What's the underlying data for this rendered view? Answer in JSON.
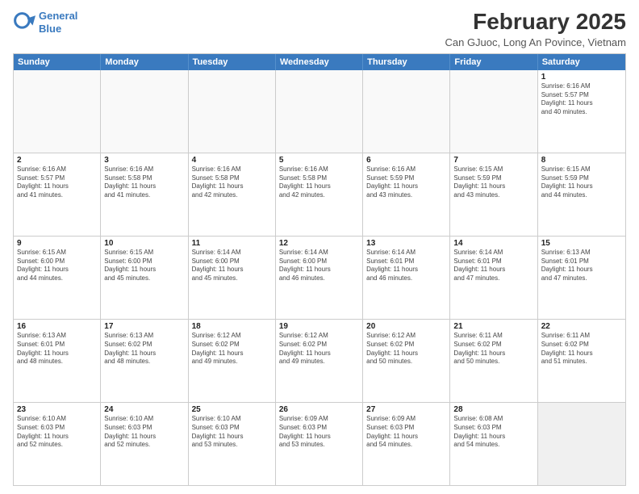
{
  "header": {
    "logo_line1": "General",
    "logo_line2": "Blue",
    "month_title": "February 2025",
    "subtitle": "Can GJuoc, Long An Povince, Vietnam"
  },
  "weekdays": [
    "Sunday",
    "Monday",
    "Tuesday",
    "Wednesday",
    "Thursday",
    "Friday",
    "Saturday"
  ],
  "weeks": [
    [
      {
        "day": "",
        "info": ""
      },
      {
        "day": "",
        "info": ""
      },
      {
        "day": "",
        "info": ""
      },
      {
        "day": "",
        "info": ""
      },
      {
        "day": "",
        "info": ""
      },
      {
        "day": "",
        "info": ""
      },
      {
        "day": "1",
        "info": "Sunrise: 6:16 AM\nSunset: 5:57 PM\nDaylight: 11 hours\nand 40 minutes."
      }
    ],
    [
      {
        "day": "2",
        "info": "Sunrise: 6:16 AM\nSunset: 5:57 PM\nDaylight: 11 hours\nand 41 minutes."
      },
      {
        "day": "3",
        "info": "Sunrise: 6:16 AM\nSunset: 5:58 PM\nDaylight: 11 hours\nand 41 minutes."
      },
      {
        "day": "4",
        "info": "Sunrise: 6:16 AM\nSunset: 5:58 PM\nDaylight: 11 hours\nand 42 minutes."
      },
      {
        "day": "5",
        "info": "Sunrise: 6:16 AM\nSunset: 5:58 PM\nDaylight: 11 hours\nand 42 minutes."
      },
      {
        "day": "6",
        "info": "Sunrise: 6:16 AM\nSunset: 5:59 PM\nDaylight: 11 hours\nand 43 minutes."
      },
      {
        "day": "7",
        "info": "Sunrise: 6:15 AM\nSunset: 5:59 PM\nDaylight: 11 hours\nand 43 minutes."
      },
      {
        "day": "8",
        "info": "Sunrise: 6:15 AM\nSunset: 5:59 PM\nDaylight: 11 hours\nand 44 minutes."
      }
    ],
    [
      {
        "day": "9",
        "info": "Sunrise: 6:15 AM\nSunset: 6:00 PM\nDaylight: 11 hours\nand 44 minutes."
      },
      {
        "day": "10",
        "info": "Sunrise: 6:15 AM\nSunset: 6:00 PM\nDaylight: 11 hours\nand 45 minutes."
      },
      {
        "day": "11",
        "info": "Sunrise: 6:14 AM\nSunset: 6:00 PM\nDaylight: 11 hours\nand 45 minutes."
      },
      {
        "day": "12",
        "info": "Sunrise: 6:14 AM\nSunset: 6:00 PM\nDaylight: 11 hours\nand 46 minutes."
      },
      {
        "day": "13",
        "info": "Sunrise: 6:14 AM\nSunset: 6:01 PM\nDaylight: 11 hours\nand 46 minutes."
      },
      {
        "day": "14",
        "info": "Sunrise: 6:14 AM\nSunset: 6:01 PM\nDaylight: 11 hours\nand 47 minutes."
      },
      {
        "day": "15",
        "info": "Sunrise: 6:13 AM\nSunset: 6:01 PM\nDaylight: 11 hours\nand 47 minutes."
      }
    ],
    [
      {
        "day": "16",
        "info": "Sunrise: 6:13 AM\nSunset: 6:01 PM\nDaylight: 11 hours\nand 48 minutes."
      },
      {
        "day": "17",
        "info": "Sunrise: 6:13 AM\nSunset: 6:02 PM\nDaylight: 11 hours\nand 48 minutes."
      },
      {
        "day": "18",
        "info": "Sunrise: 6:12 AM\nSunset: 6:02 PM\nDaylight: 11 hours\nand 49 minutes."
      },
      {
        "day": "19",
        "info": "Sunrise: 6:12 AM\nSunset: 6:02 PM\nDaylight: 11 hours\nand 49 minutes."
      },
      {
        "day": "20",
        "info": "Sunrise: 6:12 AM\nSunset: 6:02 PM\nDaylight: 11 hours\nand 50 minutes."
      },
      {
        "day": "21",
        "info": "Sunrise: 6:11 AM\nSunset: 6:02 PM\nDaylight: 11 hours\nand 50 minutes."
      },
      {
        "day": "22",
        "info": "Sunrise: 6:11 AM\nSunset: 6:02 PM\nDaylight: 11 hours\nand 51 minutes."
      }
    ],
    [
      {
        "day": "23",
        "info": "Sunrise: 6:10 AM\nSunset: 6:03 PM\nDaylight: 11 hours\nand 52 minutes."
      },
      {
        "day": "24",
        "info": "Sunrise: 6:10 AM\nSunset: 6:03 PM\nDaylight: 11 hours\nand 52 minutes."
      },
      {
        "day": "25",
        "info": "Sunrise: 6:10 AM\nSunset: 6:03 PM\nDaylight: 11 hours\nand 53 minutes."
      },
      {
        "day": "26",
        "info": "Sunrise: 6:09 AM\nSunset: 6:03 PM\nDaylight: 11 hours\nand 53 minutes."
      },
      {
        "day": "27",
        "info": "Sunrise: 6:09 AM\nSunset: 6:03 PM\nDaylight: 11 hours\nand 54 minutes."
      },
      {
        "day": "28",
        "info": "Sunrise: 6:08 AM\nSunset: 6:03 PM\nDaylight: 11 hours\nand 54 minutes."
      },
      {
        "day": "",
        "info": ""
      }
    ]
  ]
}
